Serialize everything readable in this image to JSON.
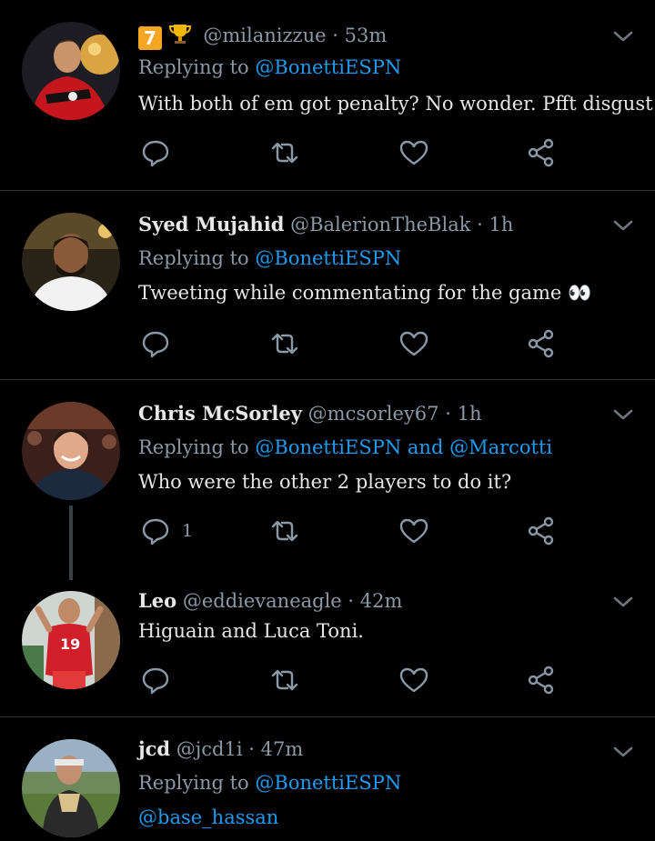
{
  "tweets": [
    {
      "emoji": [
        "7",
        "trophy"
      ],
      "name": "",
      "handle": "@milanizzue",
      "time": "53m",
      "replying_prefix": "Replying to ",
      "replying_to": "@BonettiESPN",
      "replying_and": "",
      "replying_to2": "",
      "text": "With both of em got penalty? No wonder. Pfft disgust",
      "reply_count": ""
    },
    {
      "name": "Syed Mujahid",
      "handle": "@BalerionTheBlak",
      "time": "1h",
      "replying_prefix": "Replying to ",
      "replying_to": "@BonettiESPN",
      "text": "Tweeting while commentating for the game 👀",
      "reply_count": ""
    },
    {
      "name": "Chris McSorley",
      "handle": "@mcsorley67",
      "time": "1h",
      "replying_prefix": "Replying to ",
      "replying_to": "@BonettiESPN",
      "replying_and": " and ",
      "replying_to2": "@Marcotti",
      "text": "Who were the other 2 players to do it?",
      "reply_count": "1"
    },
    {
      "name": "Leo",
      "handle": "@eddievaneagle",
      "time": "42m",
      "text": "Higuain and Luca Toni.",
      "reply_count": ""
    },
    {
      "name": "jcd",
      "handle": "@jcd1i",
      "time": "47m",
      "replying_prefix": "Replying to ",
      "replying_to": "@BonettiESPN",
      "text": "@base_hassan"
    }
  ],
  "separator": "·",
  "colors": {
    "background": "#000000",
    "mention": "#1d9bf0",
    "muted": "#8b98a5",
    "divider": "#2f3336"
  },
  "icons": [
    "reply-icon",
    "retweet-icon",
    "like-icon",
    "share-icon",
    "chevron-down-icon"
  ]
}
